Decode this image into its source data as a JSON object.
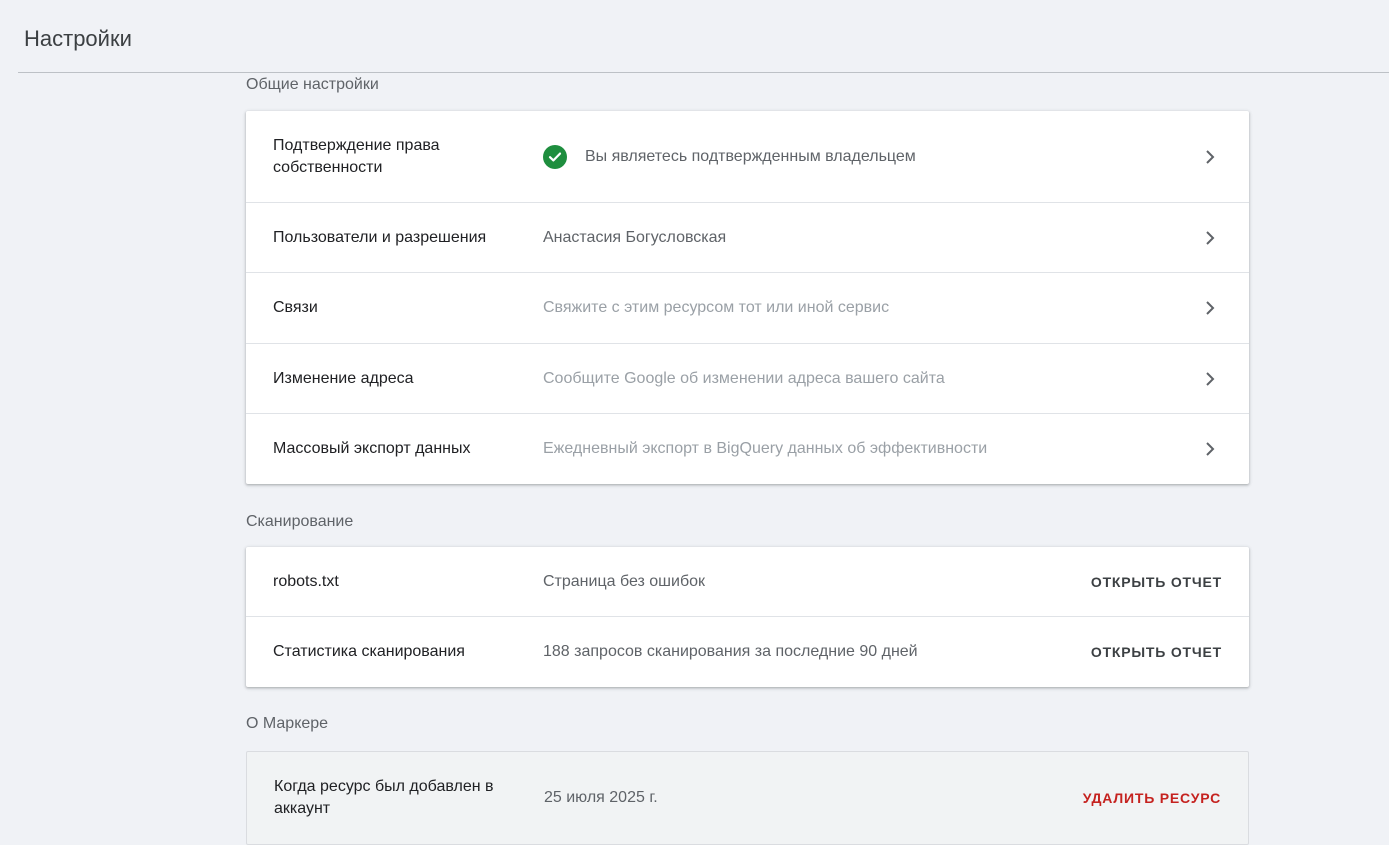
{
  "header": {
    "title": "Настройки"
  },
  "sections": {
    "general": {
      "title": "Общие настройки",
      "rows": [
        {
          "label": "Подтверждение права собственности",
          "value": "Вы являетесь подтвержденным владельцем",
          "icon": "check-circle-icon"
        },
        {
          "label": "Пользователи и разрешения",
          "value": "Анастасия Богусловская"
        },
        {
          "label": "Связи",
          "value": "Свяжите с этим ресурсом тот или иной сервис"
        },
        {
          "label": "Изменение адреса",
          "value": "Сообщите Google об изменении адреса вашего сайта"
        },
        {
          "label": "Массовый экспорт данных",
          "value": "Ежедневный экспорт в BigQuery данных об эффективности"
        }
      ]
    },
    "crawling": {
      "title": "Сканирование",
      "rows": [
        {
          "label": "robots.txt",
          "value": "Страница без ошибок",
          "action": "ОТКРЫТЬ ОТЧЕТ"
        },
        {
          "label": "Статистика сканирования",
          "value": "188 запросов сканирования за последние 90 дней",
          "action": "ОТКРЫТЬ ОТЧЕТ"
        }
      ]
    },
    "about": {
      "title": "О Маркере",
      "rows": [
        {
          "label": "Когда ресурс был добавлен в аккаунт",
          "value": "25 июля 2025 г.",
          "action": "УДАЛИТЬ РЕСУРС"
        }
      ]
    }
  },
  "colors": {
    "background": "#f0f2f6",
    "success": "#1e8e3e",
    "danger": "#c5221f"
  }
}
